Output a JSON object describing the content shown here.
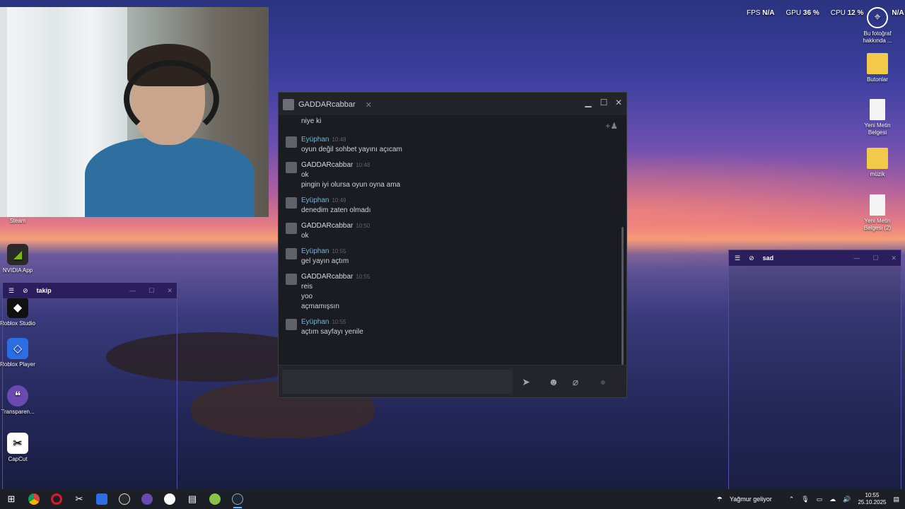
{
  "overlay": {
    "fps_label": "FPS",
    "fps_value": "N/A",
    "gpu_label": "GPU",
    "gpu_value": "36 %",
    "cpu_label": "CPU",
    "cpu_value": "12 %",
    "extra_value": "N/A"
  },
  "desktop_icons_left": [
    {
      "label": "Steam"
    },
    {
      "label": "NVIDIA App"
    },
    {
      "label": "Roblox Studio"
    },
    {
      "label": "Roblox Player"
    },
    {
      "label": "Transparen..."
    },
    {
      "label": "CapCut"
    }
  ],
  "desktop_icons_right": [
    {
      "label": "Bu fotoğraf hakkında ..."
    },
    {
      "label": "Butonlar"
    },
    {
      "label": "Yeni Metin Belgesi"
    },
    {
      "label": "müzik"
    },
    {
      "label": "Yeni Metin Belgesi (2)"
    }
  ],
  "chat": {
    "tab_name": "GADDARcabbar",
    "messages": [
      {
        "name": "",
        "time": "",
        "lines": [
          "niye ki"
        ],
        "self": false
      },
      {
        "name": "Eyüphan",
        "time": "10:48",
        "lines": [
          "oyun değil sohbet yayını açıcam"
        ],
        "self": true
      },
      {
        "name": "GADDARcabbar",
        "time": "10:48",
        "lines": [
          "ok",
          "pingin iyi olursa oyun oyna ama"
        ],
        "self": false
      },
      {
        "name": "Eyüphan",
        "time": "10:49",
        "lines": [
          "denedim zaten olmadı"
        ],
        "self": true
      },
      {
        "name": "GADDARcabbar",
        "time": "10:50",
        "lines": [
          "ok"
        ],
        "self": false
      },
      {
        "name": "Eyüphan",
        "time": "10:55",
        "lines": [
          "gel yayın açtım"
        ],
        "self": true
      },
      {
        "name": "GADDARcabbar",
        "time": "10:55",
        "lines": [
          "reis",
          "yoo",
          "açmamışsın"
        ],
        "self": false
      },
      {
        "name": "Eyüphan",
        "time": "10:55",
        "lines": [
          "açtım sayfayı yenile"
        ],
        "self": true
      }
    ]
  },
  "windows": {
    "takip_title": "takip",
    "sad_title": "sad"
  },
  "taskbar": {
    "weather": "Yağmur geliyor",
    "time": "10:55",
    "date": "25.10.2025"
  }
}
